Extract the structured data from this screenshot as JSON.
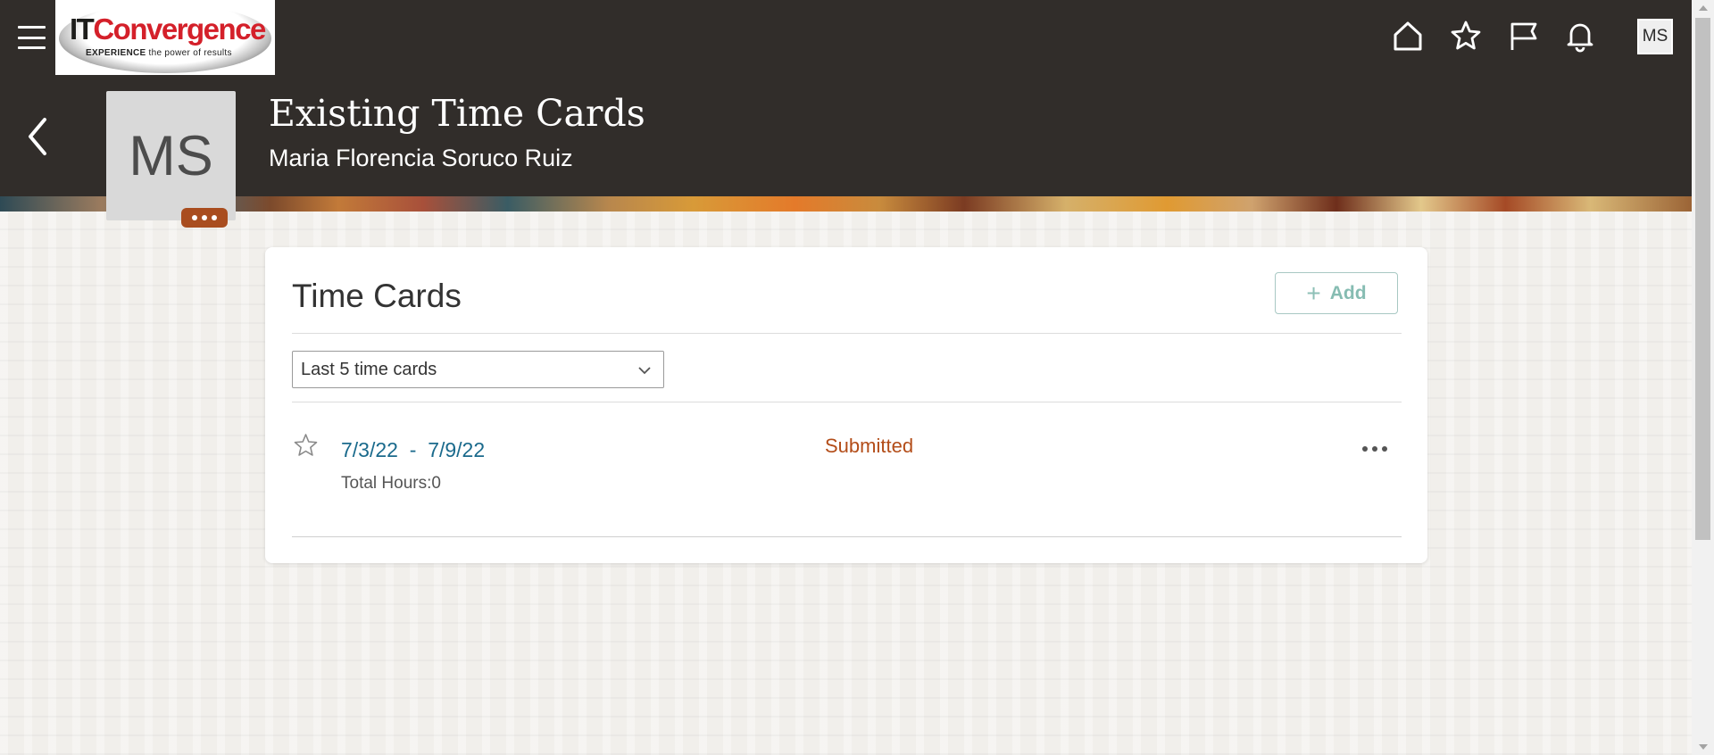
{
  "header": {
    "menu_icon": "hamburger-icon",
    "logo": {
      "brand_it": "IT",
      "brand_rest": "Convergence",
      "tagline_bold": "EXPERIENCE",
      "tagline_rest": " the power of results"
    },
    "icons": [
      "home-icon",
      "favorites-star-icon",
      "flag-icon",
      "notifications-bell-icon"
    ],
    "user_initials": "MS"
  },
  "page": {
    "back_icon": "back-chevron-icon",
    "avatar_initials": "MS",
    "title": "Existing Time Cards",
    "subtitle": "Maria Florencia Soruco Ruiz"
  },
  "time_cards": {
    "title": "Time Cards",
    "add_label": "Add",
    "filter": {
      "selected": "Last 5 time cards"
    },
    "rows": [
      {
        "start_date": "7/3/22",
        "separator": "  -  ",
        "end_date": "7/9/22",
        "hours_label": "Total Hours:0",
        "status": "Submitted"
      }
    ]
  },
  "colors": {
    "header_bg": "#312d2a",
    "link": "#1a6a8c",
    "status_submitted": "#b34d19",
    "add_button_text": "#86bcb2"
  }
}
